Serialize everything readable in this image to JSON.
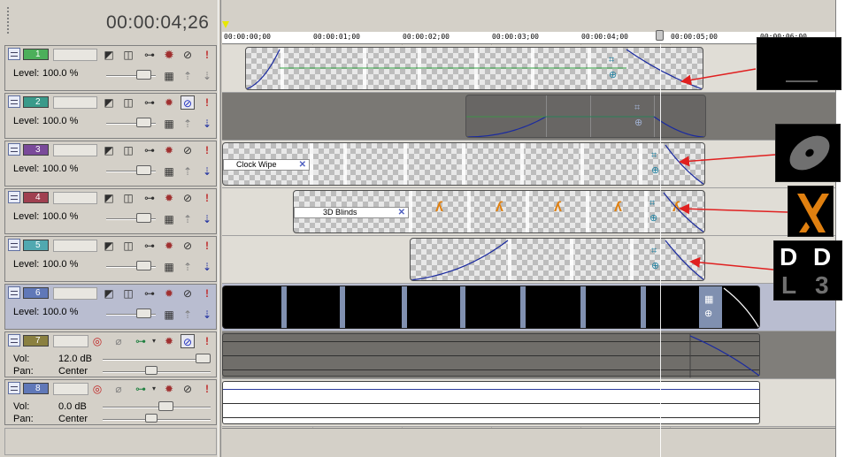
{
  "header": {
    "timecode": "00:00:04;26"
  },
  "ruler": {
    "labels": [
      "00:00:00;00",
      "00:00:01;00",
      "00:00:02;00",
      "00:00:03;00",
      "00:00:04;00",
      "00:00:05;00",
      "00:00:06;00"
    ]
  },
  "video_tracks": [
    {
      "num": "1",
      "color": "#4caf5a",
      "level_label": "Level:",
      "level_value": "100.0 %",
      "level_fraction": 0.9
    },
    {
      "num": "2",
      "color": "#3a9a8a",
      "level_label": "Level:",
      "level_value": "100.0 %",
      "level_fraction": 0.9
    },
    {
      "num": "3",
      "color": "#7a4a9a",
      "level_label": "Level:",
      "level_value": "100.0 %",
      "level_fraction": 0.9
    },
    {
      "num": "4",
      "color": "#a04050",
      "level_label": "Level:",
      "level_value": "100.0 %",
      "level_fraction": 0.9
    },
    {
      "num": "5",
      "color": "#50a8b0",
      "level_label": "Level:",
      "level_value": "100.0 %",
      "level_fraction": 0.9
    },
    {
      "num": "6",
      "color": "#6078b8",
      "level_label": "Level:",
      "level_value": "100.0 %",
      "level_fraction": 0.9
    }
  ],
  "audio_tracks": [
    {
      "num": "7",
      "color": "#8a8040",
      "vol_label": "Vol:",
      "vol_value": "12.0 dB",
      "pan_label": "Pan:",
      "pan_value": "Center",
      "vol_fraction": 1.0
    },
    {
      "num": "8",
      "color": "#6078b8",
      "vol_label": "Vol:",
      "vol_value": "0.0 dB",
      "pan_label": "Pan:",
      "pan_value": "Center",
      "vol_fraction": 0.6
    }
  ],
  "transitions": {
    "t3": "Clock Wipe",
    "t4": "3D Blinds"
  },
  "icons": [
    "track-collapse-icon",
    "compositing-mode-icon",
    "parent-motion-icon",
    "track-motion-icon",
    "track-fx-icon",
    "mute-icon",
    "solo-icon",
    "film-strip-icon",
    "arrow-icon"
  ],
  "colors": {
    "accent_red": "#e02020",
    "envelope_blue": "#1a2aa0"
  }
}
